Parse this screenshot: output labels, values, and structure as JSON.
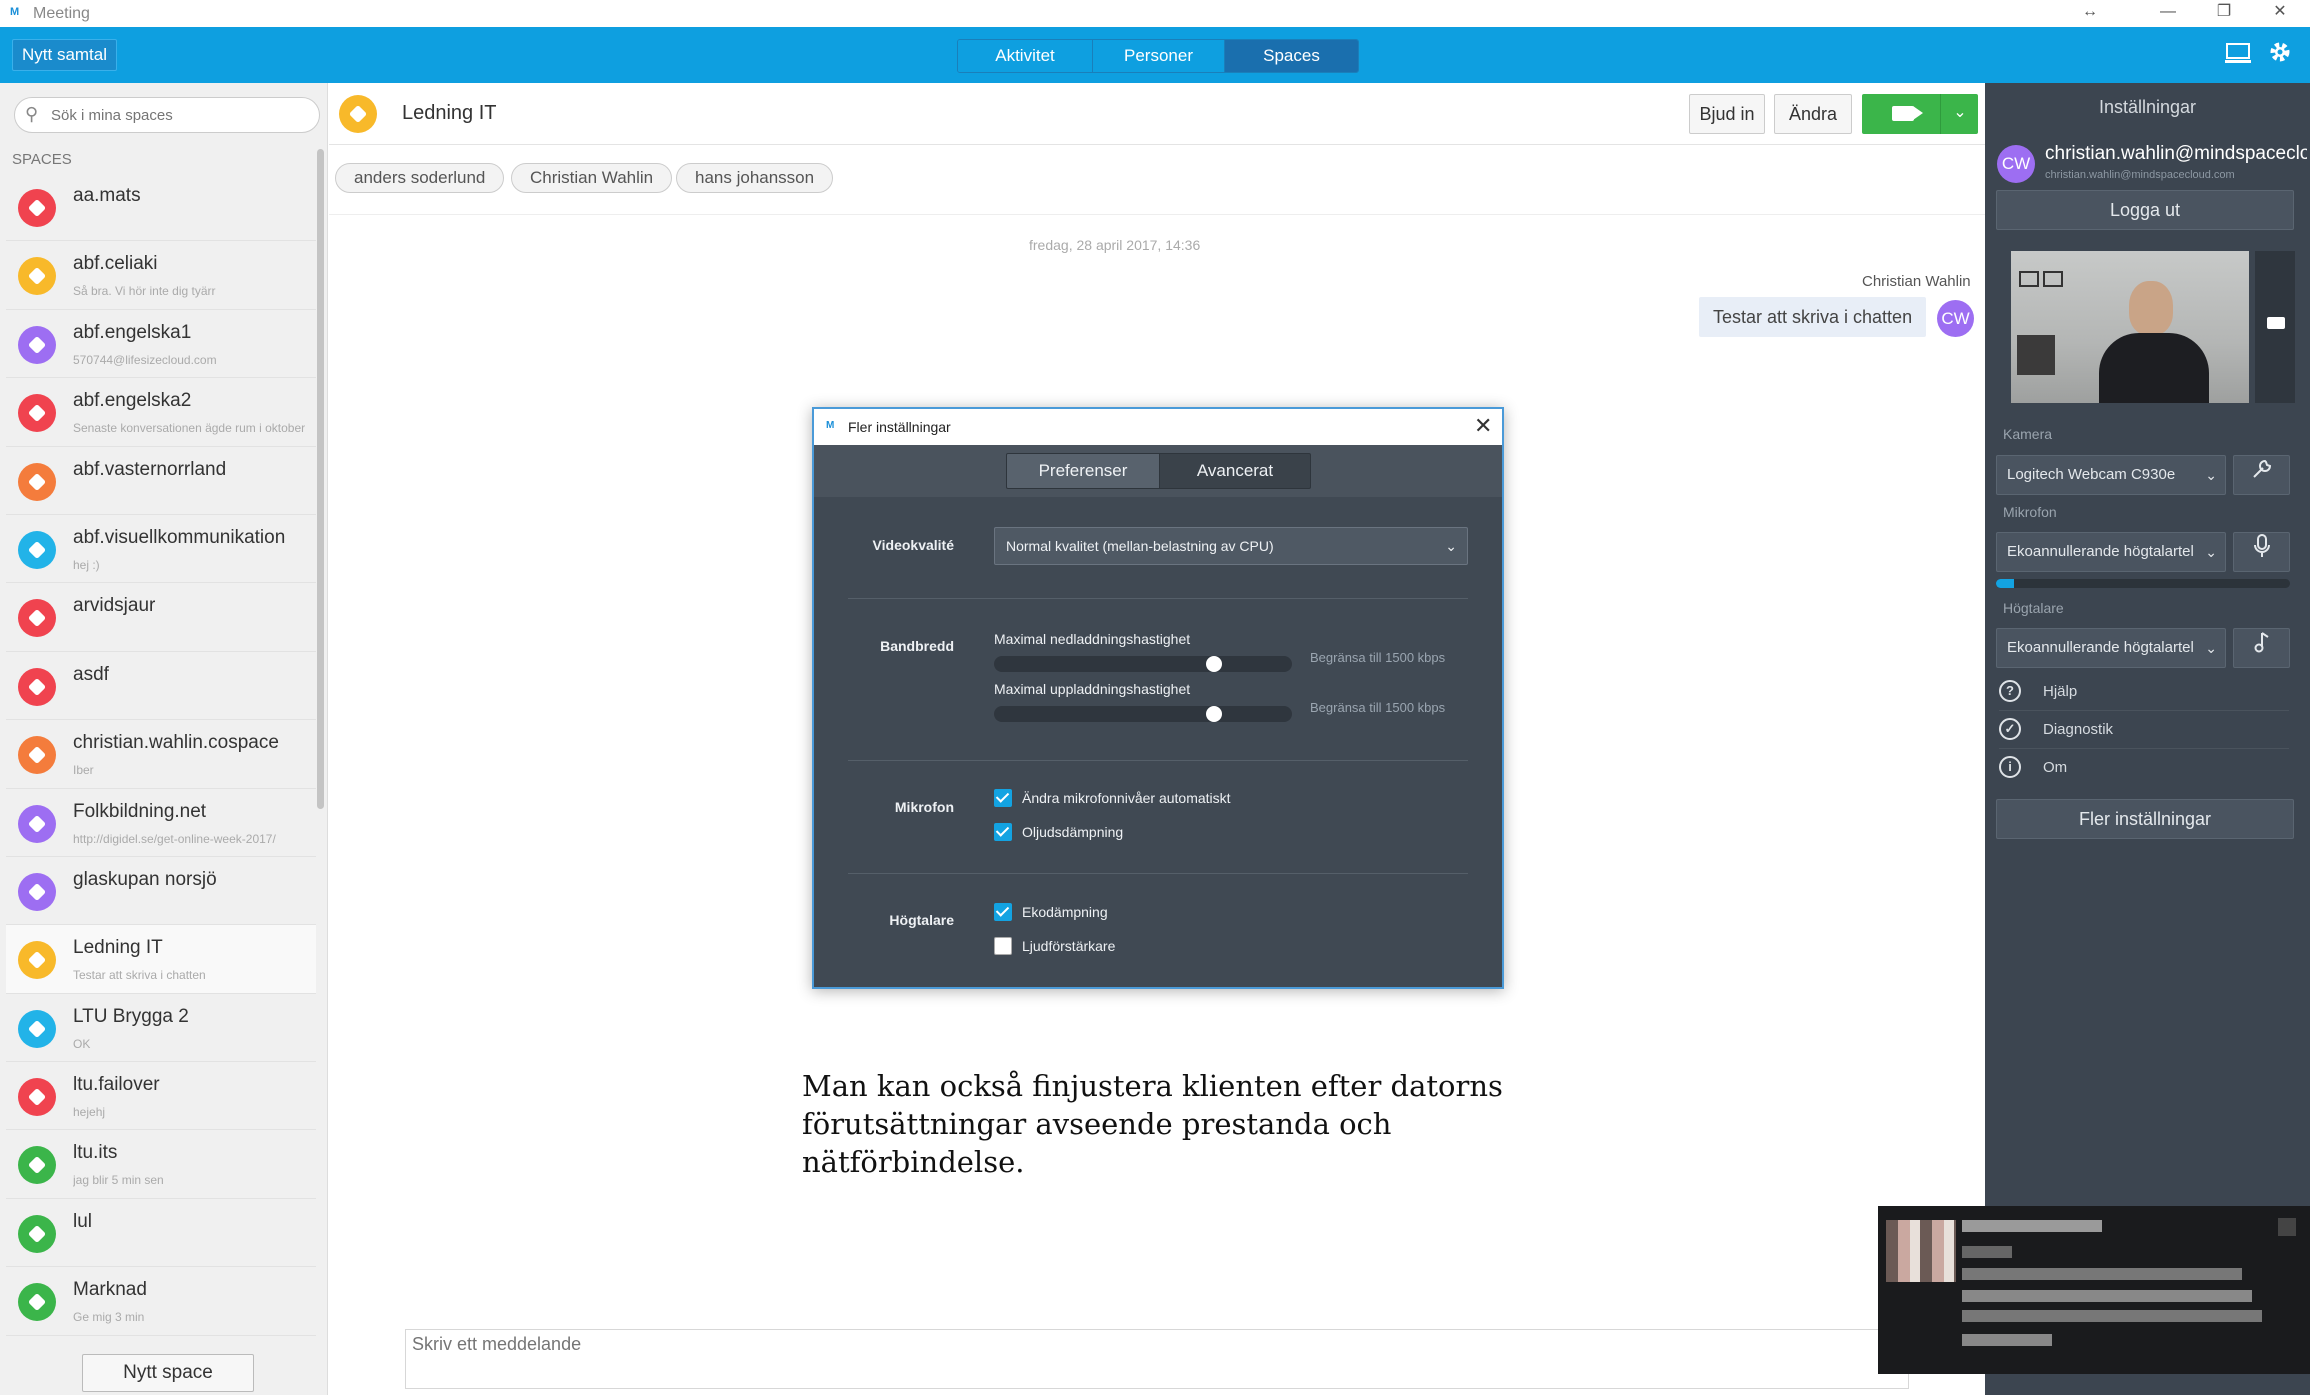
{
  "window": {
    "title": "Meeting",
    "app_icon": "M",
    "controls": [
      "↔",
      "—",
      "❐",
      "✕"
    ]
  },
  "topbar": {
    "new_call_label": "Nytt samtal",
    "tabs": [
      {
        "label": "Aktivitet",
        "active": false
      },
      {
        "label": "Personer",
        "active": false
      },
      {
        "label": "Spaces",
        "active": true
      }
    ],
    "icons": [
      "screen-icon",
      "gear-icon"
    ]
  },
  "sidebar": {
    "search_placeholder": "Sök i mina spaces",
    "spaces_header": "SPACES",
    "items": [
      {
        "name": "aa.mats",
        "sub": "",
        "color": "#f0434f"
      },
      {
        "name": "abf.celiaki",
        "sub": "Så bra. Vi hör inte dig tyärr",
        "color": "#f8b92a"
      },
      {
        "name": "abf.engelska1",
        "sub": "570744@lifesizecloud.com",
        "color": "#9d6ef2"
      },
      {
        "name": "abf.engelska2",
        "sub": "Senaste konversationen ägde rum i oktober",
        "color": "#f0434f"
      },
      {
        "name": "abf.vasternorrland",
        "sub": "",
        "color": "#f47c3c"
      },
      {
        "name": "abf.visuellkommunikation",
        "sub": "hej :)",
        "color": "#22b3e8"
      },
      {
        "name": "arvidsjaur",
        "sub": "",
        "color": "#f0434f"
      },
      {
        "name": "asdf",
        "sub": "",
        "color": "#f0434f"
      },
      {
        "name": "christian.wahlin.cospace",
        "sub": "Iber",
        "color": "#f47c3c"
      },
      {
        "name": "Folkbildning.net",
        "sub": "http://digidel.se/get-online-week-2017/",
        "color": "#9d6ef2"
      },
      {
        "name": "glaskupan norsjö",
        "sub": "",
        "color": "#9d6ef2"
      },
      {
        "name": "Ledning IT",
        "sub": "Testar att skriva i chatten",
        "color": "#f8b92a",
        "active": true
      },
      {
        "name": "LTU Brygga 2",
        "sub": "OK",
        "color": "#22b3e8"
      },
      {
        "name": "ltu.failover",
        "sub": "hejehj",
        "color": "#f0434f"
      },
      {
        "name": "ltu.its",
        "sub": "jag blir 5 min sen",
        "color": "#3bb54a"
      },
      {
        "name": "lul",
        "sub": "",
        "color": "#3bb54a"
      },
      {
        "name": "Marknad",
        "sub": "Ge mig 3 min",
        "color": "#3bb54a"
      }
    ],
    "new_space_label": "Nytt space"
  },
  "conversation": {
    "title": "Ledning IT",
    "invite_label": "Bjud in",
    "edit_label": "Ändra",
    "participants": [
      "anders soderlund",
      "Christian Wahlin",
      "hans johansson"
    ],
    "date_label": "fredag, 28 april 2017, 14:36",
    "sender": "Christian Wahlin",
    "message": "Testar att skriva i chatten",
    "sender_initials": "CW",
    "composer_placeholder": "Skriv ett meddelande",
    "caption": "Man kan också finjustera klienten efter datorns förutsättningar avseende prestanda och nätförbindelse."
  },
  "settings_panel": {
    "title": "Inställningar",
    "initials": "CW",
    "user_name": "christian.wahlin@mindspacecloud.com",
    "user_email": "christian.wahlin@mindspacecloud.com",
    "logout_label": "Logga ut",
    "camera_label": "Kamera",
    "camera_value": "Logitech Webcam C930e",
    "mic_label": "Mikrofon",
    "mic_value": "Ekoannullerande högtalartel",
    "mic_level": 0.06,
    "speaker_label": "Högtalare",
    "speaker_value": "Ekoannullerande högtalartel",
    "menu": [
      {
        "icon": "help-icon",
        "glyph": "?",
        "label": "Hjälp"
      },
      {
        "icon": "diagnostics-icon",
        "glyph": "✓",
        "label": "Diagnostik"
      },
      {
        "icon": "info-icon",
        "glyph": "i",
        "label": "Om"
      }
    ],
    "more_settings_label": "Fler inställningar"
  },
  "modal": {
    "title": "Fler inställningar",
    "tabs": [
      {
        "label": "Preferenser",
        "active": true
      },
      {
        "label": "Avancerat",
        "active": false
      }
    ],
    "video_quality_label": "Videokvalité",
    "video_quality_value": "Normal kvalitet (mellan-belastning av CPU)",
    "bandwidth_label": "Bandbredd",
    "download_label": "Maximal nedladdningshastighet",
    "download_hint": "Begränsa till 1500 kbps",
    "download_value": 0.75,
    "upload_label": "Maximal uppladdningshastighet",
    "upload_hint": "Begränsa till 1500 kbps",
    "upload_value": 0.75,
    "microphone_label": "Mikrofon",
    "mic_options": [
      {
        "label": "Ändra mikrofonnivåer automatiskt",
        "checked": true
      },
      {
        "label": "Oljudsdämpning",
        "checked": true
      }
    ],
    "speaker_label": "Högtalare",
    "speaker_options": [
      {
        "label": "Ekodämpning",
        "checked": true
      },
      {
        "label": "Ljudförstärkare",
        "checked": false
      }
    ]
  }
}
